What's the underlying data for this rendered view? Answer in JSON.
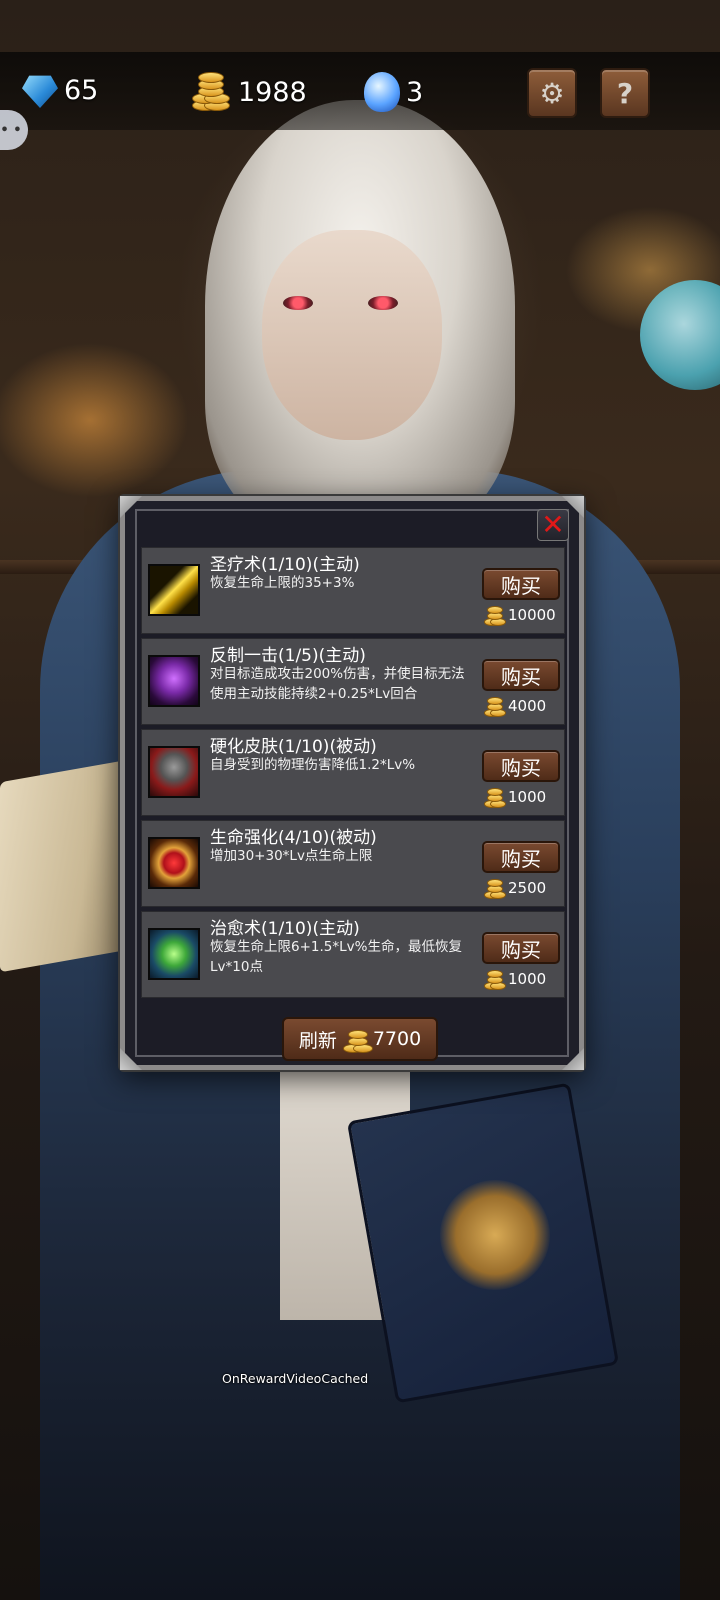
{
  "resources": {
    "gems": "65",
    "gold": "1988",
    "crystals": "3"
  },
  "icons": {
    "gem": "blue-gem-cluster-icon",
    "gold": "gold-coin-stack-icon",
    "crystal": "blue-crystal-icon",
    "settings": "gear-icon",
    "help": "question-mark-icon",
    "chat": "chat-bubble-icon",
    "close": "close-x-icon"
  },
  "toolbar": {
    "help_label": "?",
    "close_label": "✕"
  },
  "shop": {
    "skills": [
      {
        "name": "圣疗术(1/10)(主动)",
        "description": "恢复生命上限的35+3%",
        "button": "购买",
        "price": "10000",
        "icon": "golden-light-slash-icon"
      },
      {
        "name": "反制一击(1/5)(主动)",
        "description": "对目标造成攻击200%伤害，并使目标无法使用主动技能持续2+0.25*Lv回合",
        "button": "购买",
        "price": "4000",
        "icon": "purple-demon-icon"
      },
      {
        "name": "硬化皮肤(1/10)(被动)",
        "description": "自身受到的物理伤害降低1.2*Lv%",
        "button": "购买",
        "price": "1000",
        "icon": "armored-knight-icon"
      },
      {
        "name": "生命强化(4/10)(被动)",
        "description": "增加30+30*Lv点生命上限",
        "button": "购买",
        "price": "2500",
        "icon": "heart-icon"
      },
      {
        "name": "治愈术(1/10)(主动)",
        "description": "恢复生命上限6+1.5*Lv%生命，最低恢复Lv*10点",
        "button": "购买",
        "price": "1000",
        "icon": "green-leaf-icon"
      }
    ],
    "refresh_label": "刷新",
    "refresh_price": "7700"
  },
  "debug_text": "OnRewardVideoCached",
  "colors": {
    "panel_bg": "#1c1c26",
    "row_bg": "#4a4a4e",
    "button_brown": "#6a3d25",
    "close_red": "#e01818"
  }
}
